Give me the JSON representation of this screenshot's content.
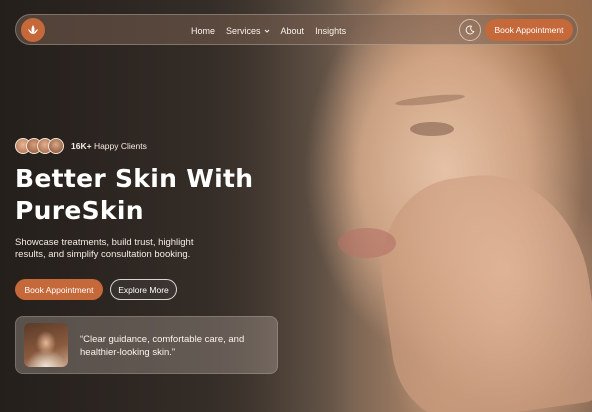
{
  "nav": {
    "links": [
      {
        "label": "Home"
      },
      {
        "label": "Services",
        "has_dropdown": true
      },
      {
        "label": "About"
      },
      {
        "label": "Insights"
      }
    ],
    "cta_label": "Book Appointment",
    "logo_icon": "lotus-icon",
    "theme_icon": "moon-icon"
  },
  "hero": {
    "clients_count": "16K+",
    "clients_label": "Happy Clients",
    "headline_line1": "Better Skin With",
    "headline_line2": "PureSkin",
    "subtext": "Showcase treatments, build trust, highlight results, and simplify consultation booking.",
    "primary_cta": "Book Appointment",
    "secondary_cta": "Explore More"
  },
  "testimonial": {
    "quote": "“Clear guidance, comfortable care, and healthier-looking skin.”"
  },
  "colors": {
    "accent": "#c5683a",
    "text_light": "#fbf3ec"
  }
}
